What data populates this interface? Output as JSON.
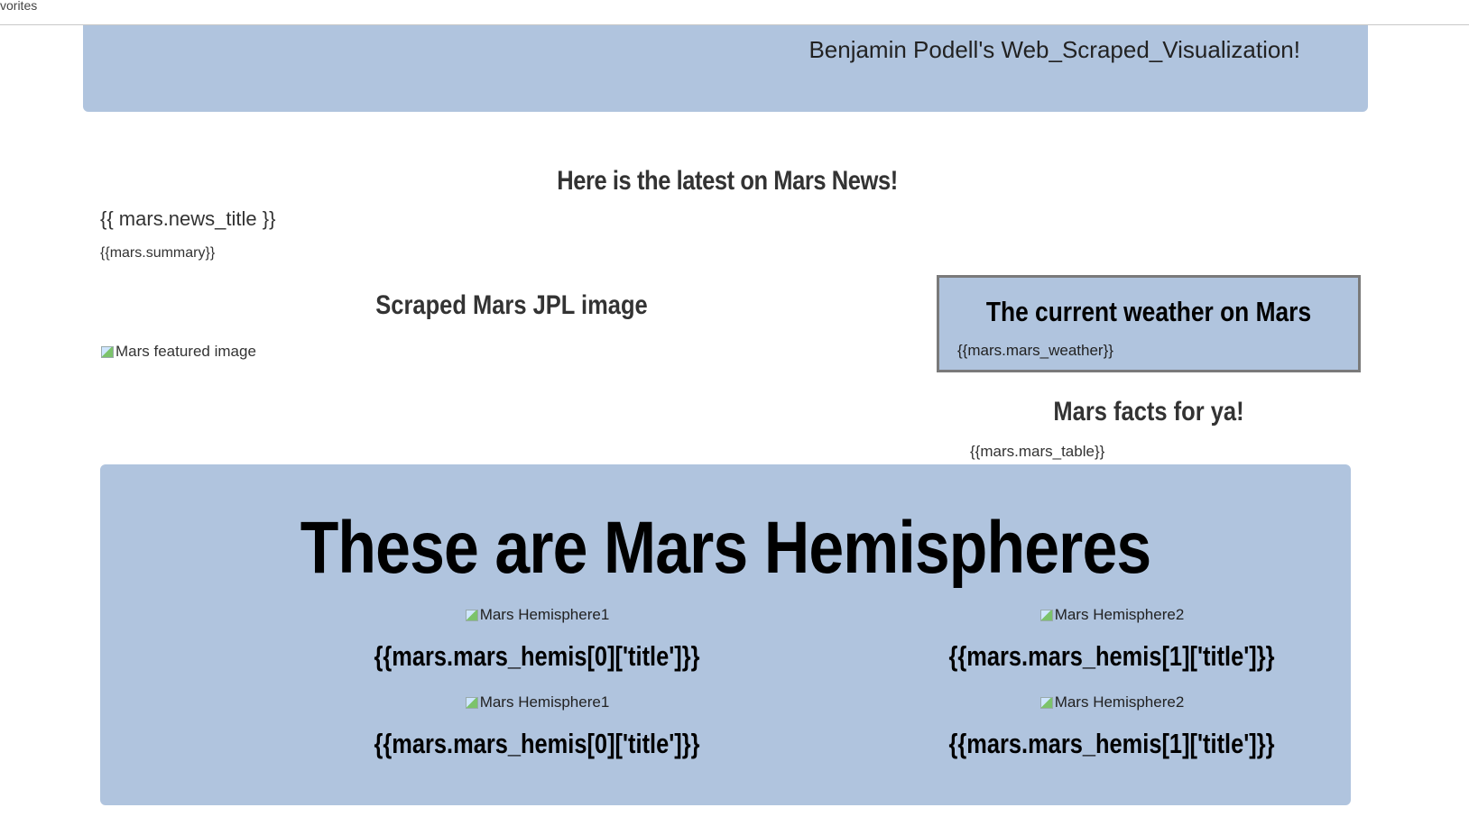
{
  "browser": {
    "favorites_label": "vorites"
  },
  "header": {
    "title": "Benjamin Podell's Web_Scraped_Visualization!"
  },
  "news": {
    "heading": "Here is the latest on Mars News!",
    "title": "{{ mars.news_title }}",
    "summary": "{{mars.summary}}"
  },
  "featured": {
    "heading": "Scraped Mars JPL image",
    "image_alt": "Mars featured image"
  },
  "weather": {
    "heading": "The current weather on Mars",
    "text": "{{mars.mars_weather}}"
  },
  "facts": {
    "heading": "Mars facts for ya!",
    "table": "{{mars.mars_table}}"
  },
  "hemispheres": {
    "heading": "These are Mars Hemispheres",
    "items": [
      {
        "image_alt": "Mars Hemisphere1",
        "title": "{{mars.mars_hemis[0]['title']}}"
      },
      {
        "image_alt": "Mars Hemisphere2",
        "title": "{{mars.mars_hemis[1]['title']}}"
      },
      {
        "image_alt": "Mars Hemisphere1",
        "title": "{{mars.mars_hemis[0]['title']}}"
      },
      {
        "image_alt": "Mars Hemisphere2",
        "title": "{{mars.mars_hemis[1]['title']}}"
      }
    ]
  },
  "colors": {
    "panel": "#b0c4de",
    "border": "#7a7a7a"
  }
}
